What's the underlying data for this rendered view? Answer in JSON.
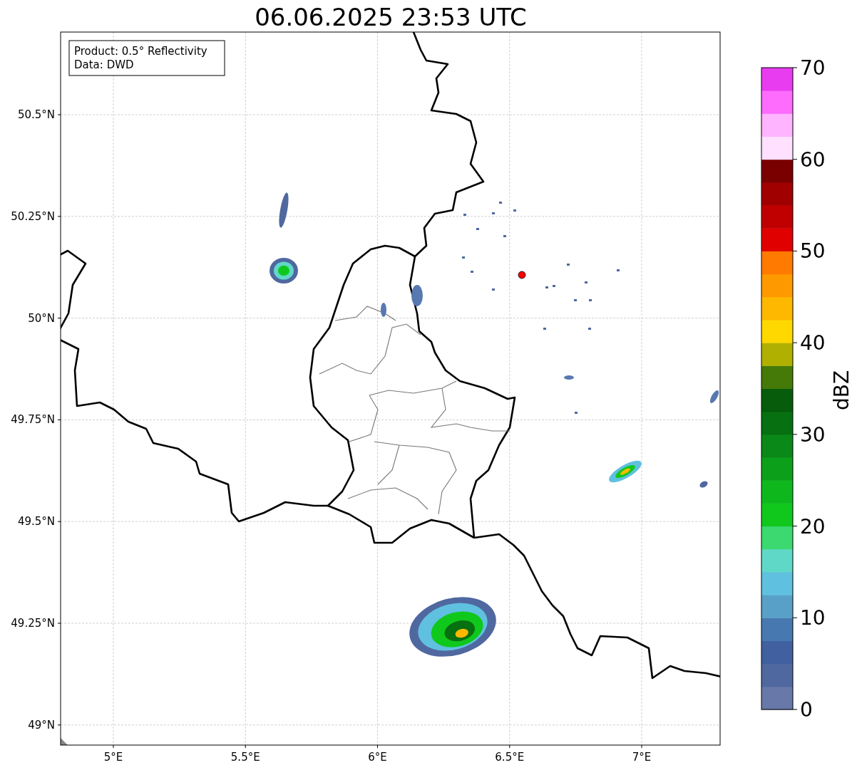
{
  "title": "06.06.2025 23:53 UTC",
  "info_box": {
    "lines": [
      "Product: 0.5° Reflectivity",
      "Data: DWD"
    ]
  },
  "map": {
    "lat_labels": [
      "50.5°N",
      "50.25°N",
      "50°N",
      "49.75°N",
      "49.5°N",
      "49.25°N",
      "49°N"
    ],
    "lon_labels": [
      "5°E",
      "5.5°E",
      "6°E",
      "6.5°E",
      "7°E"
    ]
  },
  "colorbar": {
    "label": "dBZ",
    "ticks": [
      "70",
      "60",
      "50",
      "40",
      "30",
      "20",
      "10",
      "0"
    ],
    "bins": [
      {
        "color": "#6878a8"
      },
      {
        "color": "#5068a0"
      },
      {
        "color": "#4060a0"
      },
      {
        "color": "#4878b0"
      },
      {
        "color": "#58a0c8"
      },
      {
        "color": "#60c0e0"
      },
      {
        "color": "#60d8c8"
      },
      {
        "color": "#3cd870"
      },
      {
        "color": "#10c81c"
      },
      {
        "color": "#0eb81c"
      },
      {
        "color": "#0ca01a"
      },
      {
        "color": "#0a8818"
      },
      {
        "color": "#077010"
      },
      {
        "color": "#065c0a"
      },
      {
        "color": "#457a08"
      },
      {
        "color": "#b0b000"
      },
      {
        "color": "#ffd800"
      },
      {
        "color": "#ffb800"
      },
      {
        "color": "#fe9a00"
      },
      {
        "color": "#fe7a00"
      },
      {
        "color": "#e00000"
      },
      {
        "color": "#c00000"
      },
      {
        "color": "#a00000"
      },
      {
        "color": "#7a0000"
      },
      {
        "color": "#ffe0ff"
      },
      {
        "color": "#feb4fe"
      },
      {
        "color": "#fd6cfd"
      },
      {
        "color": "#e83cf0"
      }
    ]
  }
}
